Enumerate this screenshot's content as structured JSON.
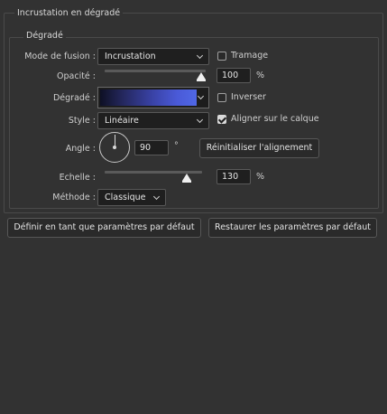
{
  "panel": {
    "title": "Incrustation en dégradé",
    "section_title": "Dégradé"
  },
  "fields": {
    "blend_mode": {
      "label": "Mode de fusion :",
      "value": "Incrustation"
    },
    "dither": {
      "label": "Tramage",
      "checked": false
    },
    "opacity": {
      "label": "Opacité :",
      "value": "100",
      "unit": "%",
      "fraction": 1.0
    },
    "gradient": {
      "label": "Dégradé :",
      "colors": [
        "#0e1024",
        "#3a43a8",
        "#5068e6"
      ]
    },
    "reverse": {
      "label": "Inverser",
      "checked": false
    },
    "style": {
      "label": "Style :",
      "value": "Linéaire"
    },
    "align_with_layer": {
      "label": "Aligner sur le calque",
      "checked": true
    },
    "angle": {
      "label": "Angle :",
      "value": "90",
      "unit": "°"
    },
    "reset_alignment": {
      "label": "Réinitialiser l'alignement"
    },
    "scale": {
      "label": "Echelle :",
      "value": "130",
      "unit": "%",
      "fraction": 0.87
    },
    "method": {
      "label": "Méthode :",
      "value": "Classique"
    }
  },
  "buttons": {
    "make_default": "Définir en tant que paramètres par défaut",
    "reset_default": "Restaurer les paramètres par défaut"
  },
  "colors": {
    "background": "#323232",
    "border": "#4a4a4a",
    "input_bg": "#1f1f1f"
  },
  "icons": {
    "chevron": "chevron-down-icon",
    "dial": "angle-dial-icon"
  }
}
